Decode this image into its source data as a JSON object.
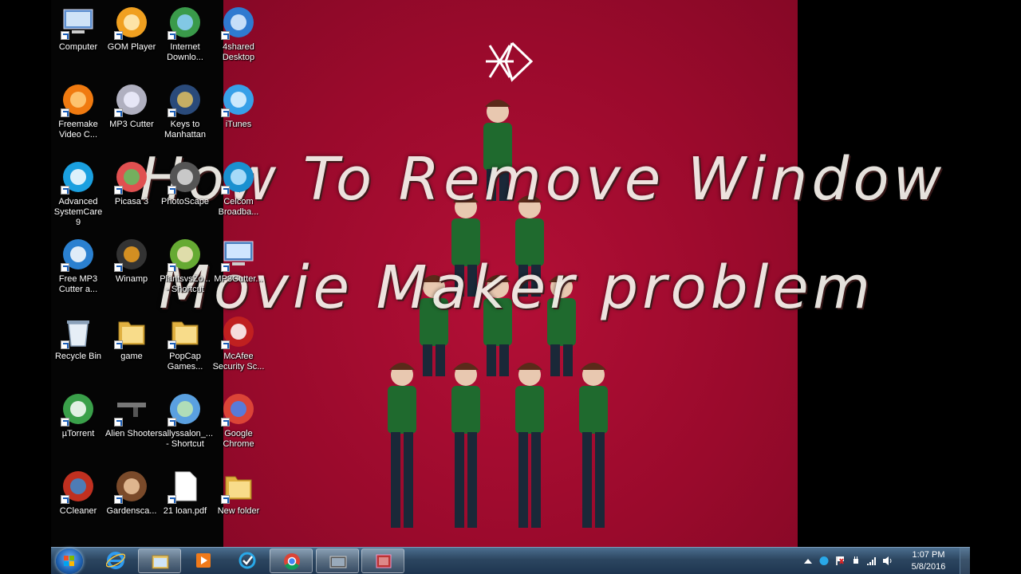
{
  "overlay": {
    "line1": "How To Remove Window",
    "line2": "Movie Maker problem"
  },
  "desktop_icons": [
    {
      "label": "Computer",
      "icon": "computer-icon"
    },
    {
      "label": "GOM Player",
      "icon": "gom-player-icon"
    },
    {
      "label": "Internet Downlo...",
      "icon": "internet-download-manager-icon"
    },
    {
      "label": "4shared Desktop",
      "icon": "4shared-icon"
    },
    {
      "label": "Freemake Video C...",
      "icon": "freemake-icon"
    },
    {
      "label": "MP3 Cutter",
      "icon": "mp3-cutter-cd-icon"
    },
    {
      "label": "Keys to Manhattan",
      "icon": "keys-to-manhattan-icon"
    },
    {
      "label": "iTunes",
      "icon": "itunes-icon"
    },
    {
      "label": "Advanced SystemCare 9",
      "icon": "advanced-systemcare-icon"
    },
    {
      "label": "Picasa 3",
      "icon": "picasa-icon"
    },
    {
      "label": "PhotoScape",
      "icon": "photoscape-icon"
    },
    {
      "label": "Celcom Broadba...",
      "icon": "celcom-broadband-icon"
    },
    {
      "label": "Free MP3 Cutter a...",
      "icon": "free-mp3-cutter-icon"
    },
    {
      "label": "Winamp",
      "icon": "winamp-icon"
    },
    {
      "label": "PlantsvsZo... - Shortcut",
      "icon": "plants-vs-zombies-icon"
    },
    {
      "label": "MP3Cutter...",
      "icon": "mp3cutter-monitor-icon"
    },
    {
      "label": "Recycle Bin",
      "icon": "recycle-bin-icon"
    },
    {
      "label": "game",
      "icon": "folder-icon"
    },
    {
      "label": "PopCap Games...",
      "icon": "popcap-folder-icon"
    },
    {
      "label": "McAfee Security Sc...",
      "icon": "mcafee-icon"
    },
    {
      "label": "µTorrent",
      "icon": "utorrent-icon"
    },
    {
      "label": "Alien Shooter",
      "icon": "alien-shooter-gun-icon"
    },
    {
      "label": "sallyssalon_... - Shortcut",
      "icon": "sallys-salon-icon"
    },
    {
      "label": "Google Chrome",
      "icon": "chrome-icon"
    },
    {
      "label": "CCleaner",
      "icon": "ccleaner-icon"
    },
    {
      "label": "Gardensca...",
      "icon": "gardenscapes-icon"
    },
    {
      "label": "21 loan.pdf",
      "icon": "pdf-file-icon"
    },
    {
      "label": "New folder",
      "icon": "folder-icon"
    }
  ],
  "taskbar": {
    "pinned": [
      "internet-explorer-icon",
      "windows-explorer-icon",
      "media-player-icon",
      "advanced-systemcare-icon",
      "chrome-icon",
      "movie-maker-icon",
      "photo-viewer-icon"
    ],
    "clock_time": "1:07 PM",
    "clock_date": "5/8/2016"
  },
  "colors": {
    "wallpaper_red": "#9a0a2c",
    "taskbar": "#2c4660",
    "overlay_text": "#f2eee8"
  }
}
